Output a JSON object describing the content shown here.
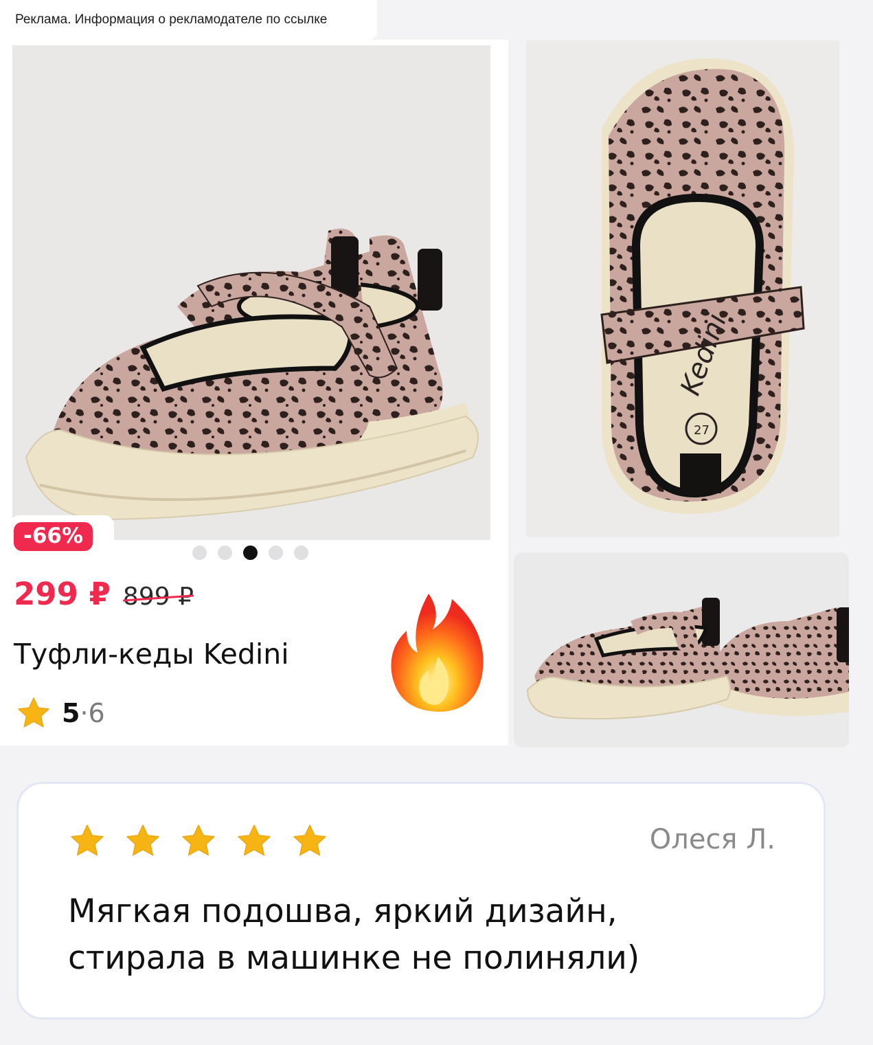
{
  "ad": {
    "label": "Реклама. Информация о рекламодателе по ссылке"
  },
  "product": {
    "discount": "-66%",
    "price_current": "299 ₽",
    "price_old": "899 ₽",
    "title": "Туфли-кеды Kedini",
    "rating_value": "5",
    "rating_count": "·6",
    "photo_count": 5,
    "active_photo_index": 2,
    "insole_brand": "Kedini",
    "insole_size": "27"
  },
  "review": {
    "stars": 5,
    "author": "Олеся Л.",
    "text_line1": "Мягкая подошва, яркий дизайн,",
    "text_line2": "стирала в машинке не полиняли)"
  },
  "colors": {
    "accent_red": "#f0294e",
    "star_gold": "#f7b515",
    "sole_cream": "#ece3c9",
    "leopard_base": "#c9a79f",
    "leopard_spot": "#2e211d"
  },
  "icons": [
    "star-icon",
    "fire-icon"
  ]
}
